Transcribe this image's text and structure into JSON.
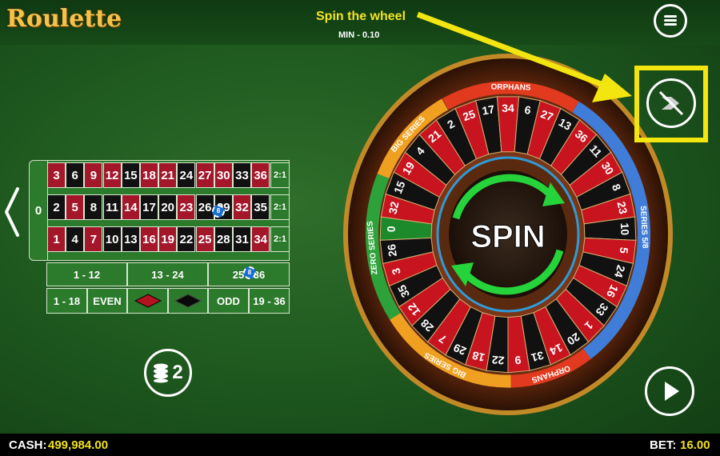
{
  "header": {
    "logo_text": "Roulette",
    "hint": "Spin the wheel",
    "min_bet": "MIN - 0.10",
    "menu_icon": "hamburger-icon"
  },
  "table": {
    "zero": "0",
    "rows": [
      [
        {
          "n": "3",
          "c": "red"
        },
        {
          "n": "6",
          "c": "black"
        },
        {
          "n": "9",
          "c": "red"
        },
        {
          "n": "12",
          "c": "red"
        },
        {
          "n": "15",
          "c": "black"
        },
        {
          "n": "18",
          "c": "red"
        },
        {
          "n": "21",
          "c": "red"
        },
        {
          "n": "24",
          "c": "black"
        },
        {
          "n": "27",
          "c": "red"
        },
        {
          "n": "30",
          "c": "red"
        },
        {
          "n": "33",
          "c": "black"
        },
        {
          "n": "36",
          "c": "red"
        }
      ],
      [
        {
          "n": "2",
          "c": "black"
        },
        {
          "n": "5",
          "c": "red"
        },
        {
          "n": "8",
          "c": "black"
        },
        {
          "n": "11",
          "c": "black"
        },
        {
          "n": "14",
          "c": "red"
        },
        {
          "n": "17",
          "c": "black"
        },
        {
          "n": "20",
          "c": "black"
        },
        {
          "n": "23",
          "c": "red"
        },
        {
          "n": "26",
          "c": "black"
        },
        {
          "n": "29",
          "c": "black"
        },
        {
          "n": "32",
          "c": "red"
        },
        {
          "n": "35",
          "c": "black"
        }
      ],
      [
        {
          "n": "1",
          "c": "red"
        },
        {
          "n": "4",
          "c": "black"
        },
        {
          "n": "7",
          "c": "red"
        },
        {
          "n": "10",
          "c": "black"
        },
        {
          "n": "13",
          "c": "black"
        },
        {
          "n": "16",
          "c": "red"
        },
        {
          "n": "19",
          "c": "red"
        },
        {
          "n": "22",
          "c": "black"
        },
        {
          "n": "25",
          "c": "red"
        },
        {
          "n": "28",
          "c": "black"
        },
        {
          "n": "31",
          "c": "black"
        },
        {
          "n": "34",
          "c": "red"
        }
      ]
    ],
    "column_bets": [
      "2:1",
      "2:1",
      "2:1"
    ],
    "dozens": [
      "1 - 12",
      "13 - 24",
      "25 - 36"
    ],
    "outside": [
      "1 - 18",
      "EVEN",
      "red",
      "black",
      "ODD",
      "19 - 36"
    ],
    "chips": [
      {
        "label": "8",
        "on": "26"
      },
      {
        "label": "8",
        "on": "25 - 36"
      }
    ]
  },
  "wheel": {
    "center_label": "SPIN",
    "sections": [
      "ORPHANS",
      "SERIES 5/8",
      "ORPHANS",
      "BIG SERIES",
      "ZERO SERIES",
      "BIG SERIES"
    ],
    "numbers": [
      "0",
      "32",
      "15",
      "19",
      "4",
      "21",
      "2",
      "25",
      "17",
      "34",
      "6",
      "27",
      "13",
      "36",
      "11",
      "30",
      "8",
      "23",
      "10",
      "5",
      "24",
      "16",
      "33",
      "1",
      "20",
      "14",
      "31",
      "9",
      "22",
      "18",
      "29",
      "7",
      "28",
      "12",
      "35",
      "3",
      "26"
    ],
    "colors": {
      "red": "#c8141f",
      "black": "#111111",
      "green": "#1c8a2a",
      "wood": "#6b2e12",
      "gold": "#d8a32b",
      "series_blue": "#3f7dd8",
      "series_orange": "#f0a020",
      "series_red": "#e23a1e",
      "series_green": "#2da23a"
    }
  },
  "controls": {
    "chip_button_label": "2",
    "chip_icon": "chip-stack-icon",
    "turbo_icon": "turbo-disabled-icon",
    "play_icon": "play-icon",
    "back_icon": "chevron-left-icon"
  },
  "footer": {
    "cash_label": "CASH:",
    "cash_value": "499,984.00",
    "bet_label": "BET:",
    "bet_value": "16.00"
  },
  "highlight_color": "#f3e50f"
}
